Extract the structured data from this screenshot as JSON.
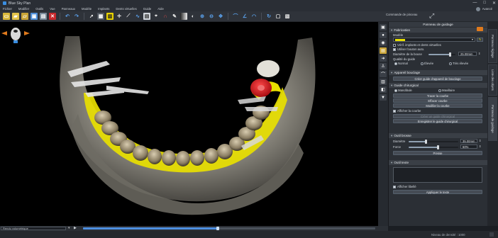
{
  "window": {
    "title": "Blue Sky Plan",
    "controls": [
      "—",
      "□",
      "✕"
    ]
  },
  "menubar": {
    "items": [
      "Fichier",
      "Modifier",
      "Outils",
      "Vue",
      "Panneaux",
      "Modèle",
      "Implants",
      "Dents virtuelles",
      "Guide",
      "Aide"
    ],
    "user": "Avancé"
  },
  "toolbar": {
    "icons": [
      "new-file",
      "open-file",
      "open-folder",
      "save",
      "print",
      "delete",
      "undo",
      "redo",
      "pointer",
      "grid",
      "layout",
      "ruler-scale",
      "crosshair",
      "ruler",
      "zoom-box",
      "teeth",
      "brush",
      "implant",
      "nerve",
      "gradient",
      "opacity",
      "contrast",
      "zoom-in",
      "zoom-out",
      "pan",
      "panoramic",
      "curve",
      "angle",
      "rotate",
      "view-2d",
      "view-3d"
    ],
    "command_label": "Commande de pinceau"
  },
  "vtools": {
    "icons": [
      "lock",
      "sphere",
      "eye",
      "layers",
      "arrow",
      "tooth",
      "jaw",
      "teeth",
      "cube",
      "arrow-down"
    ]
  },
  "panel": {
    "title": "Panneau de guidage",
    "fabrication": {
      "header": "Fabrication",
      "model_label": "Modèle",
      "chk_implants": "Vérif. implants et dents virtuelles",
      "chk_auto": "Utiliser bouton auto.",
      "sleeve_diameter_label": "Diamètre de la bouse",
      "sleeve_diameter_value": "25.00mm",
      "quality_label": "Qualité du guide",
      "quality_options": [
        "Normal",
        "Élevée",
        "Très élevée"
      ],
      "quality_selected": 0
    },
    "sleeve_section": {
      "header": "Appareil bouclage",
      "button": "Créer guide d'appareil de bouclage"
    },
    "surgical_guide": {
      "header": "Guide chirurgical",
      "jaw_options": [
        "Mandibule",
        "Maxillaire"
      ],
      "jaw_selected": 0,
      "btn_trace": "Tracer la courbe",
      "btn_erase": "Effacer courbe",
      "btn_modify": "Modifier la courbe",
      "chk_show_curve": "Afficher la courbe",
      "btn_create": "Créer un guide chirurgical",
      "btn_save": "Enregistrer le guide chirurgical"
    },
    "brush_tool": {
      "header": "Outil brosse",
      "diameter_label": "Diamètre",
      "diameter_value": "35.00mm",
      "diameter_fraction": 0.35,
      "force_label": "Force",
      "force_value": "60%",
      "force_fraction": 0.6,
      "press_button": "Presse"
    },
    "text_tool": {
      "header": "Outil texte",
      "text_value": "",
      "chk_show_label": "Afficher libellé",
      "apply_button": "Appliquer le texte"
    }
  },
  "right_tabs": [
    "Panneau réglage",
    "Liste des objets",
    "Panneau de guidage"
  ],
  "bottom": {
    "view_mode": "Rendu volumétrique",
    "timeline_fraction": 0.46
  },
  "status": {
    "text": "Niveau de densité :  1000"
  },
  "colors": {
    "guide_yellow": "#e8e000",
    "implant_red": "#d81820",
    "accent_blue": "#4d8fe0",
    "model_swatch_yellow": "#e8e000",
    "orange_button": "#e07a1c"
  }
}
